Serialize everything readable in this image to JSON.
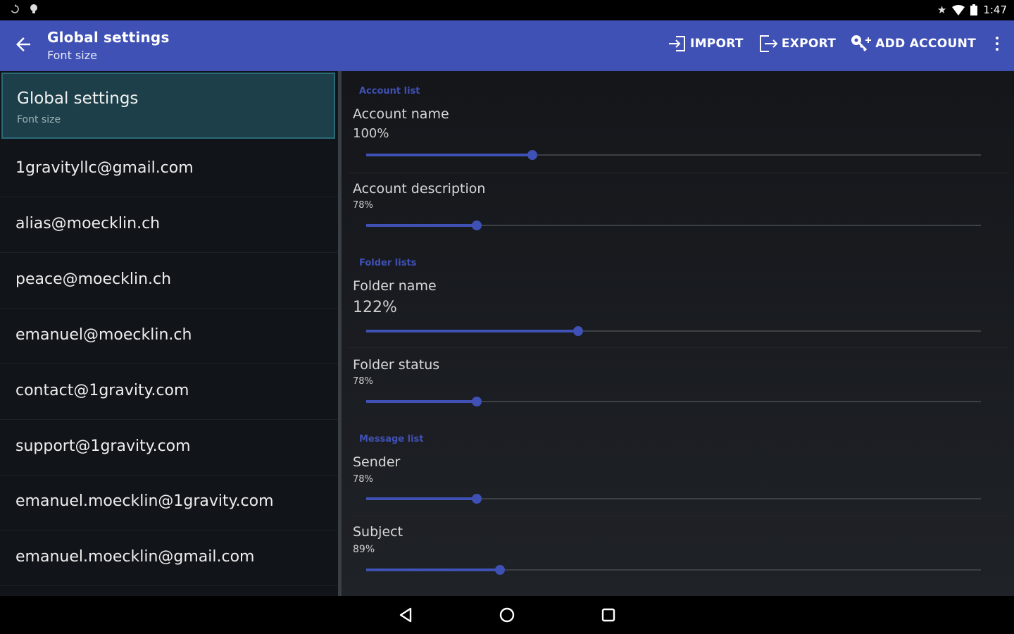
{
  "status_bar": {
    "left_icons": [
      "sync-icon",
      "notification-icon"
    ],
    "right_icons": [
      "star-icon",
      "wifi-icon",
      "battery-icon"
    ],
    "time": "1:47"
  },
  "app_bar": {
    "title": "Global settings",
    "subtitle": "Font size",
    "actions": {
      "import": "IMPORT",
      "export": "EXPORT",
      "add_account": "ADD ACCOUNT"
    },
    "accent": "#3f51b5"
  },
  "sidebar": {
    "selected": {
      "title": "Global settings",
      "subtitle": "Font size"
    },
    "accounts": [
      "1gravityllc@gmail.com",
      "alias@moecklin.ch",
      "peace@moecklin.ch",
      "emanuel@moecklin.ch",
      "contact@1gravity.com",
      "support@1gravity.com",
      "emanuel.moecklin@1gravity.com",
      "emanuel.moecklin@gmail.com"
    ]
  },
  "settings": {
    "sections": {
      "account_list": "Account list",
      "folder_lists": "Folder lists",
      "message_list": "Message list"
    },
    "prefs": [
      {
        "title": "Account name",
        "value": "100%",
        "level": 0.27
      },
      {
        "title": "Account description",
        "value": "78%",
        "level": 0.18
      },
      {
        "title": "Folder name",
        "value": "122%",
        "level": 0.345
      },
      {
        "title": "Folder status",
        "value": "78%",
        "level": 0.18
      },
      {
        "title": "Sender",
        "value": "78%",
        "level": 0.18
      },
      {
        "title": "Subject",
        "value": "89%",
        "level": 0.218
      }
    ]
  },
  "nav_bar": {
    "icons": [
      "back-triangle-icon",
      "home-circle-icon",
      "recents-square-icon"
    ]
  }
}
